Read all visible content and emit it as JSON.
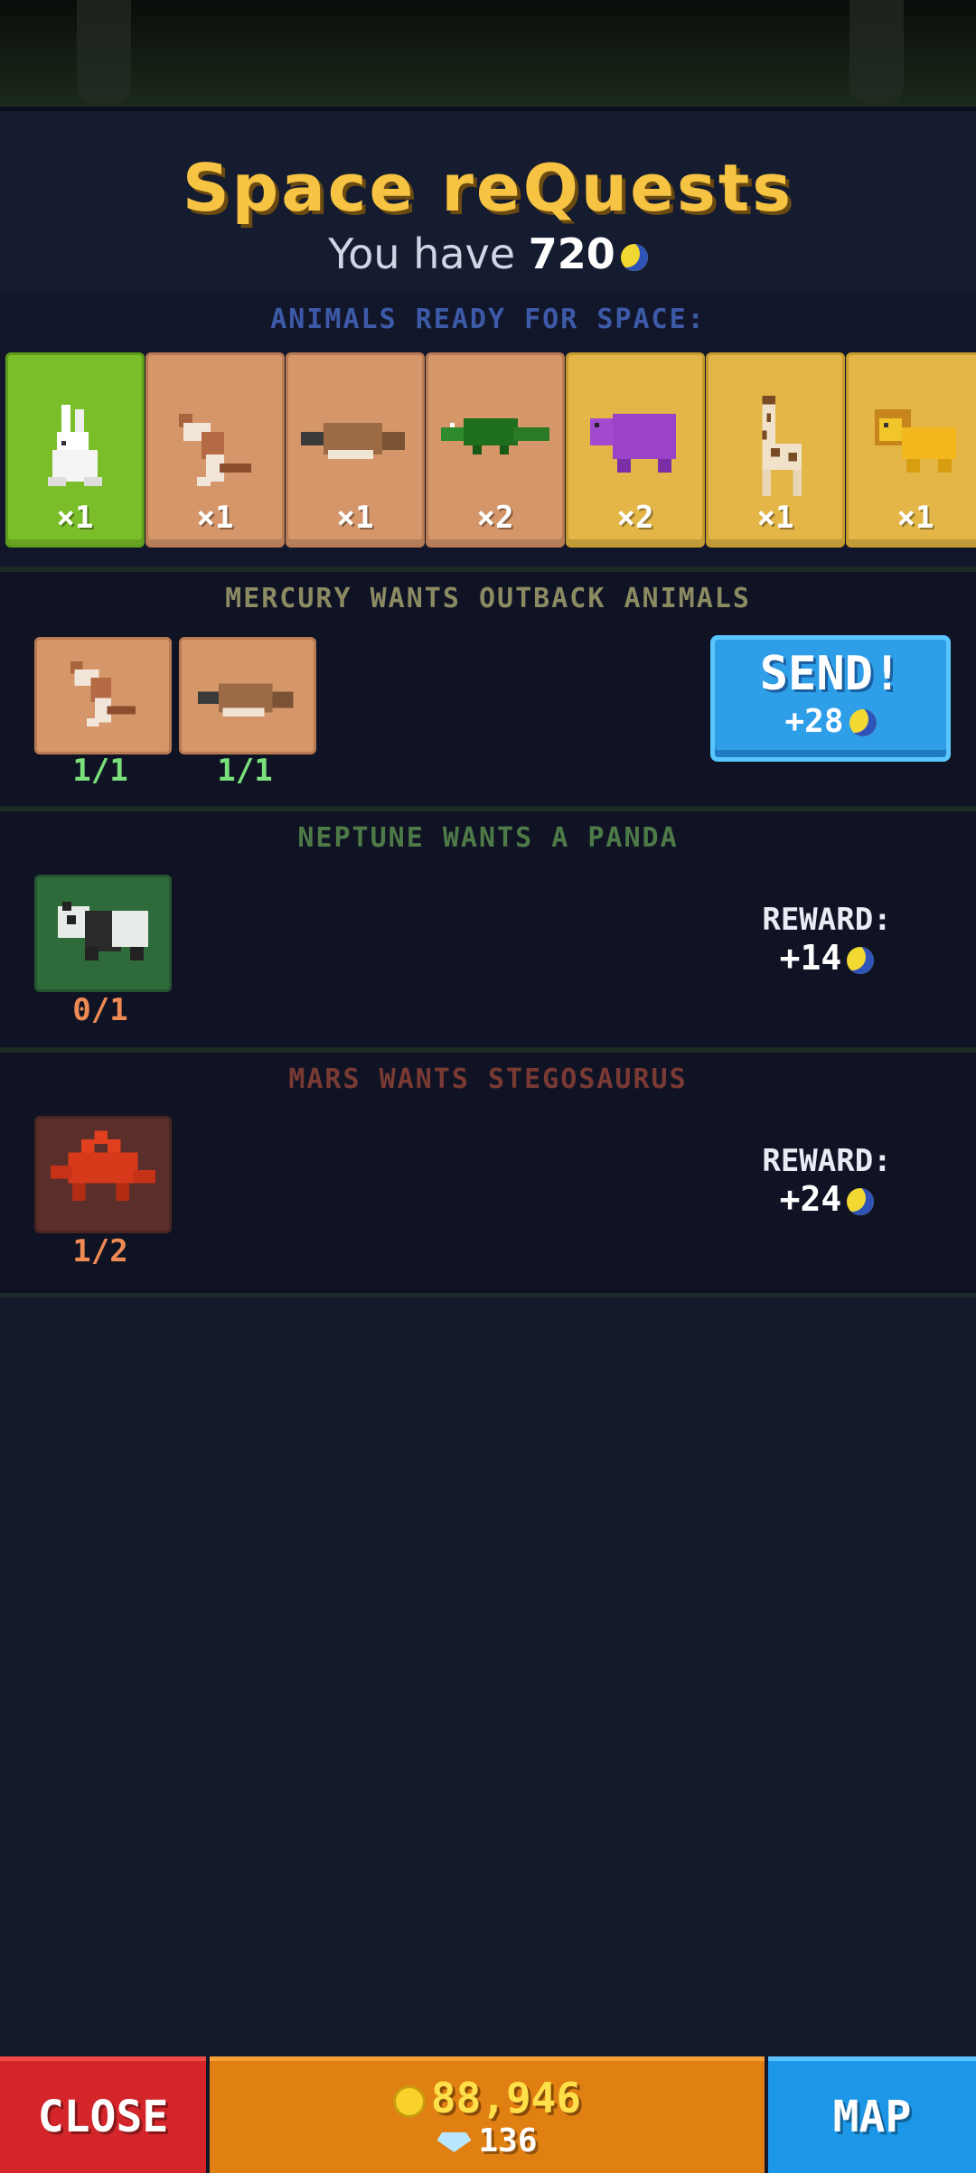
{
  "header": {
    "title": "Space reQuests",
    "you_have_label": "You have",
    "you_have_value": "720"
  },
  "ready": {
    "title": "ANIMALS READY FOR SPACE:",
    "animals": [
      {
        "name": "rabbit",
        "count": "×1",
        "card": "green"
      },
      {
        "name": "kangaroo",
        "count": "×1",
        "card": "tan"
      },
      {
        "name": "platypus",
        "count": "×1",
        "card": "tan"
      },
      {
        "name": "crocodile",
        "count": "×2",
        "card": "tan"
      },
      {
        "name": "hippo",
        "count": "×2",
        "card": "gold"
      },
      {
        "name": "giraffe",
        "count": "×1",
        "card": "gold"
      },
      {
        "name": "lion",
        "count": "×1",
        "card": "gold"
      }
    ]
  },
  "quests": [
    {
      "title": "MERCURY WANTS OUTBACK ANIMALS",
      "title_color": "#8b8a62",
      "items": [
        {
          "animal": "kangaroo",
          "progress": "1/1"
        },
        {
          "animal": "platypus",
          "progress": "1/1"
        }
      ],
      "send_label": "SEND!",
      "send_reward": "+28"
    },
    {
      "title": "NEPTUNE WANTS A PANDA",
      "title_color": "#4e7a48",
      "items": [
        {
          "animal": "panda",
          "progress": "0/1"
        }
      ],
      "reward_label": "REWARD:",
      "reward_value": "+14"
    },
    {
      "title": "MARS WANTS STEGOSAURUS",
      "title_color": "#7a3a34",
      "items": [
        {
          "animal": "stegosaurus",
          "progress": "1/2"
        }
      ],
      "reward_label": "REWARD:",
      "reward_value": "+24"
    }
  ],
  "bottom": {
    "close_label": "CLOSE",
    "coins": "88,946",
    "gems": "136",
    "map_label": "MAP"
  },
  "colors": {
    "title": "#f6c442",
    "progress_done": "#7be07b",
    "progress_pending": "#f08a54"
  }
}
